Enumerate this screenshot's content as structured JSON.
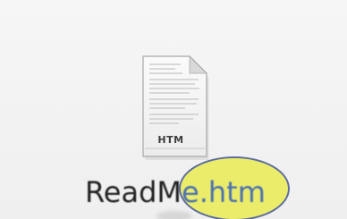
{
  "file": {
    "name_base": "ReadM",
    "name_extension": "e.htm",
    "type_badge": "HTM",
    "icon": "html-document-icon"
  },
  "annotation": {
    "shape": "ellipse",
    "fill_color": "#e9ec36",
    "stroke_color": "#5e6d9c"
  },
  "colors": {
    "background": "#f2f2f2",
    "filename_text": "#222222",
    "extension_text": "#4a6fb3"
  }
}
